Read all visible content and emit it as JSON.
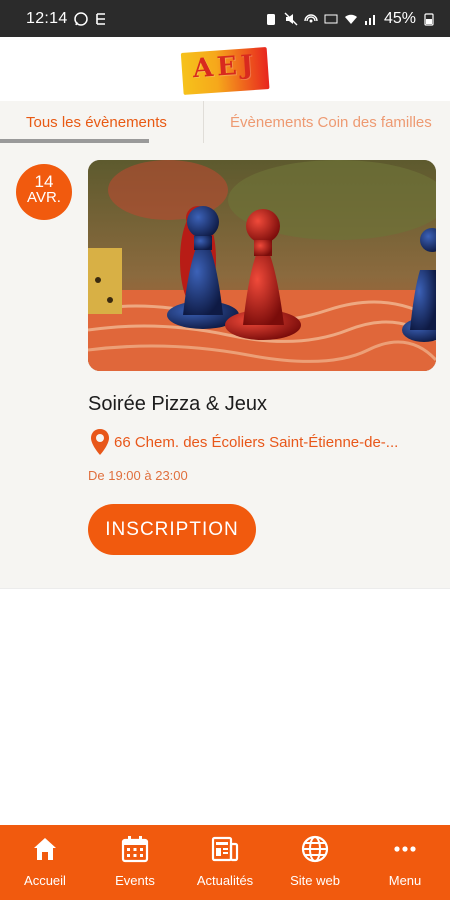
{
  "status_bar": {
    "time": "12:14",
    "battery": "45%"
  },
  "header": {
    "logo_text": "AEJ"
  },
  "tabs": [
    {
      "label": "Tous les évènements",
      "active": true
    },
    {
      "label": "Évènements Coin des familles",
      "active": false
    }
  ],
  "event": {
    "day": "14",
    "month": "AVR.",
    "title": "Soirée Pizza & Jeux",
    "address": "66 Chem. des Écoliers Saint-Étienne-de-...",
    "hours": "De 19:00 à 23:00",
    "button_label": "INSCRIPTION"
  },
  "bottom_nav": [
    {
      "label": "Accueil",
      "icon": "home-icon"
    },
    {
      "label": "Events",
      "icon": "calendar-icon"
    },
    {
      "label": "Actualités",
      "icon": "news-icon"
    },
    {
      "label": "Site web",
      "icon": "globe-icon"
    },
    {
      "label": "Menu",
      "icon": "more-icon"
    }
  ],
  "colors": {
    "accent": "#f15a0e",
    "status_bar": "#2b2b2b",
    "background": "#f6f5f2"
  }
}
